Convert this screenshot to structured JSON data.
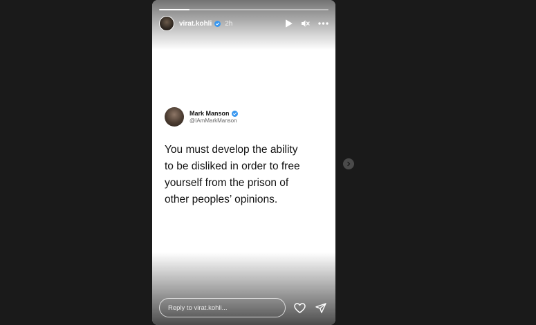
{
  "story": {
    "progress": 0.18,
    "username": "virat.kohli",
    "time": "2h",
    "verified": true
  },
  "tweet": {
    "name": "Mark Manson",
    "handle": "@IAmMarkManson",
    "verified": true,
    "text": "You must develop the ability\nto be disliked in order to free\nyourself from the prison of\nother peoples’ opinions."
  },
  "reply": {
    "placeholder": "Reply to virat.kohli..."
  },
  "icons": {
    "play": "play-icon",
    "mute": "mute-icon",
    "more": "more-icon",
    "heart": "heart-icon",
    "send": "send-icon",
    "next": "chevron-right-icon"
  },
  "colors": {
    "background": "#1a1a1a",
    "verified": "#3897f0"
  }
}
